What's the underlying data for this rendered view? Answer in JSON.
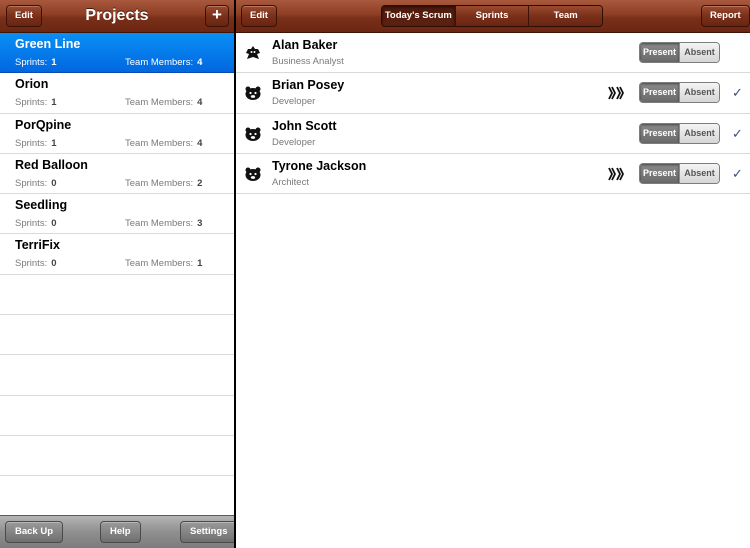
{
  "master": {
    "title": "Projects",
    "edit_label": "Edit",
    "add_label": "+",
    "sprints_label": "Sprints:",
    "members_label": "Team Members:",
    "projects": [
      {
        "name": "Green Line",
        "sprints": "1",
        "members": "4",
        "selected": true
      },
      {
        "name": "Orion",
        "sprints": "1",
        "members": "4"
      },
      {
        "name": "PorQpine",
        "sprints": "1",
        "members": "4"
      },
      {
        "name": "Red Balloon",
        "sprints": "0",
        "members": "2"
      },
      {
        "name": "Seedling",
        "sprints": "0",
        "members": "3"
      },
      {
        "name": "TerriFix",
        "sprints": "0",
        "members": "1"
      }
    ],
    "toolbar": {
      "back_label": "Back Up",
      "help_label": "Help",
      "settings_label": "Settings"
    }
  },
  "detail": {
    "edit_label": "Edit",
    "report_label": "Report",
    "tabs": [
      "Today's Scrum",
      "Sprints",
      "Team"
    ],
    "active_tab": 0,
    "present_label": "Present",
    "absent_label": "Absent",
    "members": [
      {
        "name": "Alan Baker",
        "role": "Business Analyst",
        "avatar": "bird-icon",
        "badge": false,
        "checked": false
      },
      {
        "name": "Brian Posey",
        "role": "Developer",
        "avatar": "bear-icon",
        "badge": true,
        "checked": true
      },
      {
        "name": "John Scott",
        "role": "Developer",
        "avatar": "bear-icon",
        "badge": false,
        "checked": true
      },
      {
        "name": "Tyrone Jackson",
        "role": "Architect",
        "avatar": "bear-icon",
        "badge": true,
        "checked": true
      }
    ],
    "check_glyph": "✓"
  }
}
